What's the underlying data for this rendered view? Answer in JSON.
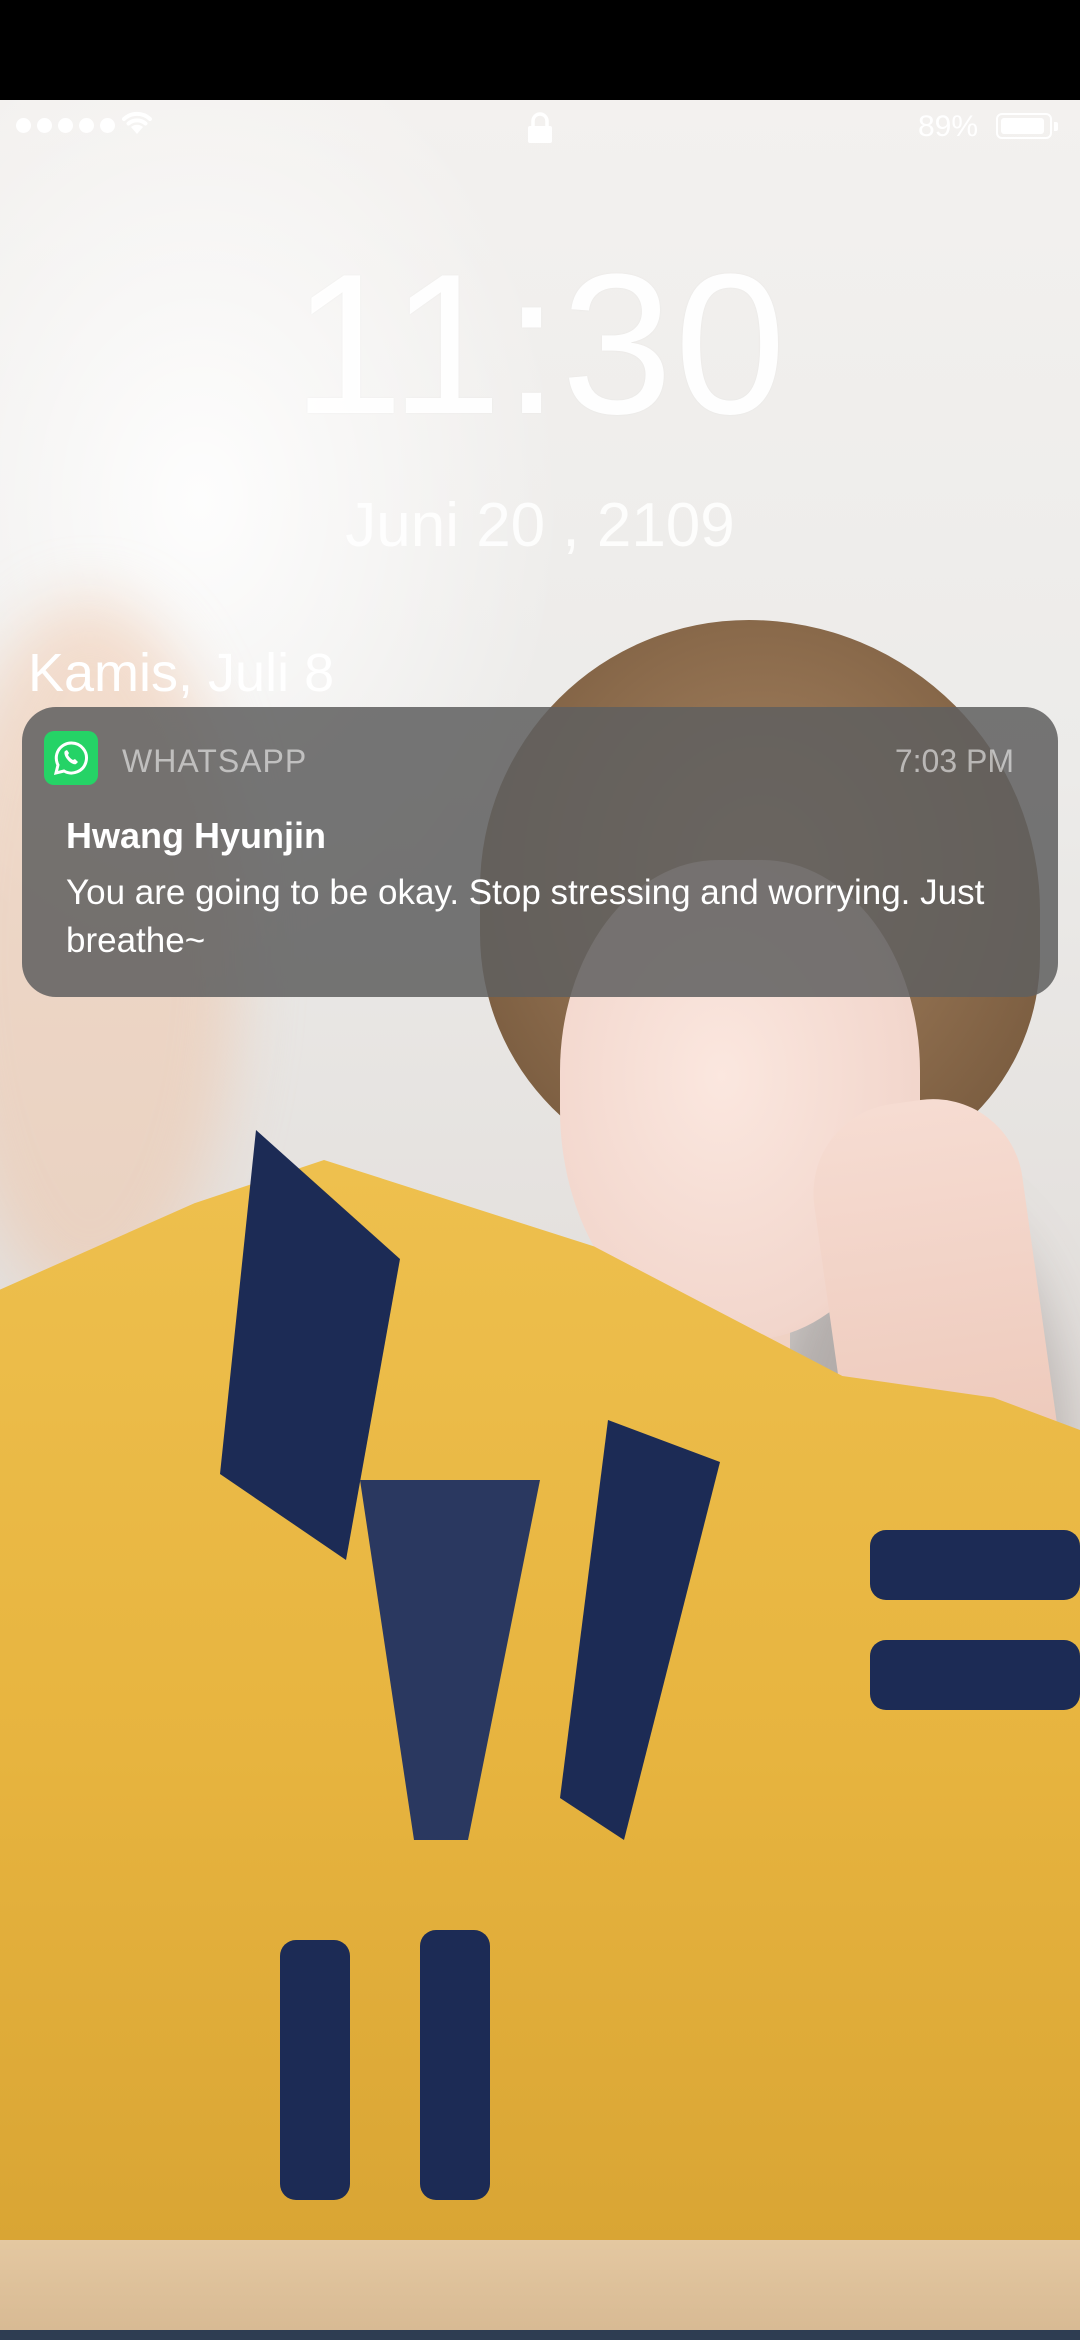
{
  "status_bar": {
    "battery_text": "89%",
    "battery_level": 0.89,
    "signal_bars": 5,
    "icons": [
      "signal-dots",
      "wifi-icon",
      "lock-icon",
      "battery-icon"
    ]
  },
  "lock_screen": {
    "time": "11:30",
    "subtitle": "Juni 20 , 2109",
    "date": "Kamis, Juli 8"
  },
  "notification": {
    "app_icon": "whatsapp-icon",
    "app_name": "WHATSAPP",
    "time": "7:03 PM",
    "sender": "Hwang Hyunjin",
    "message": "You are going to be okay. Stop stressing and worrying. Just breathe~",
    "colors": {
      "app_icon_bg": "#25d366",
      "card_bg": "#606060"
    }
  }
}
